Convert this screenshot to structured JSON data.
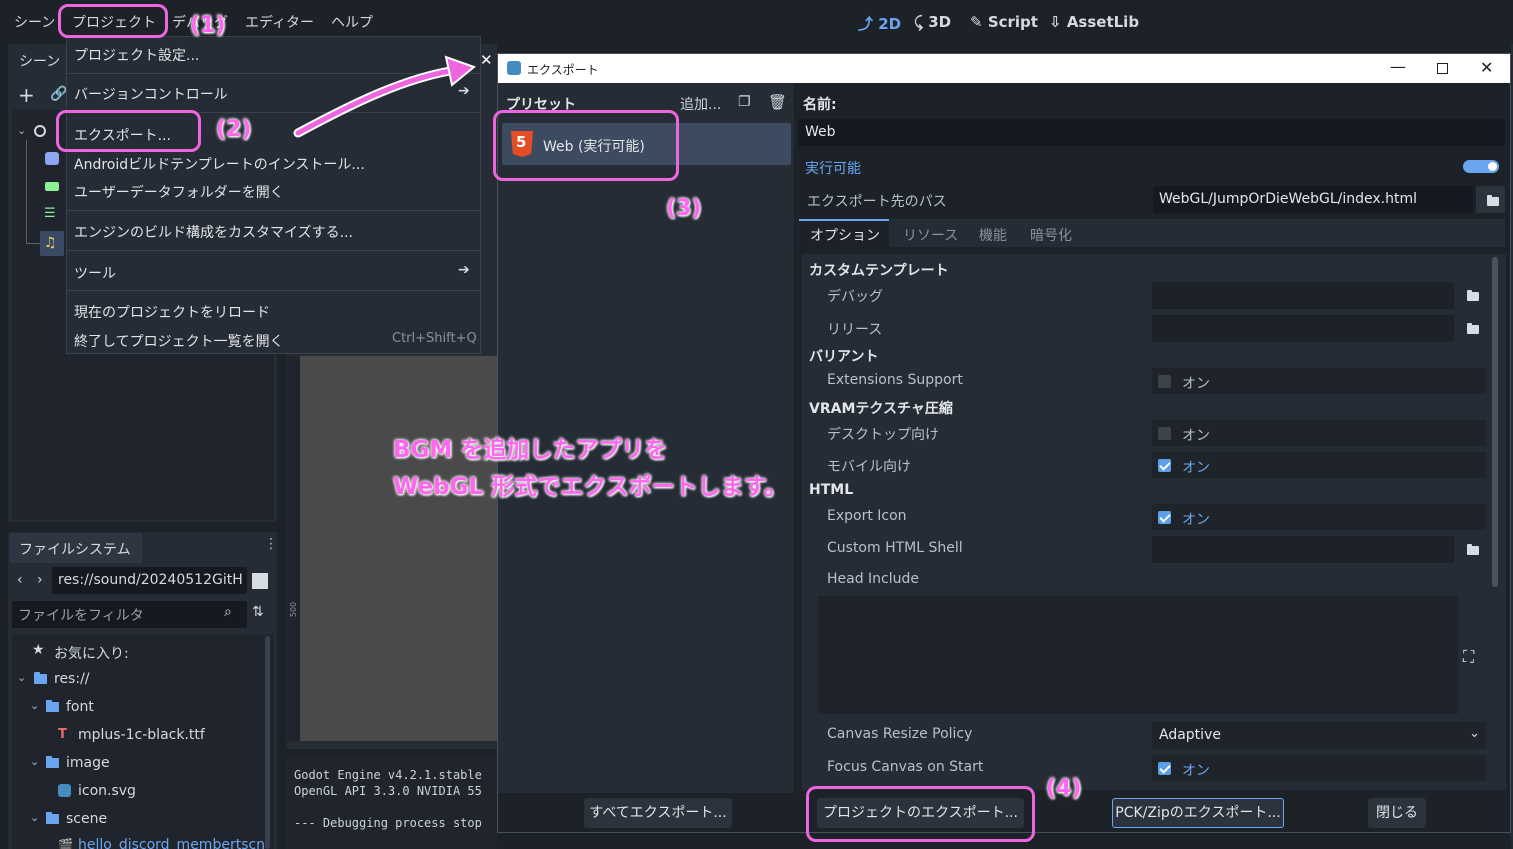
{
  "menubar": {
    "items": [
      "シーン",
      "プロジェクト",
      "デバッグ",
      "エディター",
      "ヘルプ"
    ],
    "modes": [
      "2D",
      "3D",
      "Script",
      "AssetLib"
    ]
  },
  "project_menu": {
    "items": [
      "プロジェクト設定...",
      "バージョンコントロール",
      "エクスポート...",
      "Androidビルドテンプレートのインストール...",
      "ユーザーデータフォルダーを開く",
      "エンジンのビルド構成をカスタマイズする...",
      "ツール",
      "現在のプロジェクトをリロード",
      "終了してプロジェクト一覧を開く"
    ],
    "quit_shortcut": "Ctrl+Shift+Q"
  },
  "scene_dock": {
    "tab": "シーン"
  },
  "filesystem": {
    "tab": "ファイルシステム",
    "path": "res://sound/20240512GitH",
    "filter_placeholder": "ファイルをフィルタ",
    "favorites": "お気に入り:",
    "tree": [
      "res://",
      "font",
      "mplus-1c-black.ttf",
      "image",
      "icon.svg",
      "scene",
      "hello_discord_membertscn"
    ]
  },
  "output": {
    "lines": [
      "Godot Engine v4.2.1.stable",
      "OpenGL API 3.3.0 NVIDIA 55",
      "--- Debugging process stop"
    ]
  },
  "ruler_label": "500",
  "dialog": {
    "title": "エクスポート",
    "presets_label": "プリセット",
    "add_label": "追加...",
    "preset_name": "Web (実行可能)",
    "name_label": "名前:",
    "name_value": "Web",
    "runnable_label": "実行可能",
    "export_path_label": "エクスポート先のパス",
    "export_path_value": "WebGL/JumpOrDieWebGL/index.html",
    "tabs": [
      "オプション",
      "リソース",
      "機能",
      "暗号化"
    ],
    "sections": {
      "custom_template": "カスタムテンプレート",
      "debug": "デバッグ",
      "release": "リリース",
      "variant": "バリアント",
      "extensions_support": "Extensions Support",
      "vram": "VRAMテクスチャ圧縮",
      "desktop": "デスクトップ向け",
      "mobile": "モバイル向け",
      "html": "HTML",
      "export_icon": "Export Icon",
      "custom_html_shell": "Custom HTML Shell",
      "head_include": "Head Include",
      "canvas_resize_policy": "Canvas Resize Policy",
      "canvas_resize_value": "Adaptive",
      "focus_canvas": "Focus Canvas on Start"
    },
    "on_label": "オン",
    "buttons": {
      "export_all": "すべてエクスポート...",
      "export_project": "プロジェクトのエクスポート...",
      "export_pck": "PCK/Zipのエクスポート...",
      "close": "閉じる"
    }
  },
  "annotations": {
    "step1": "(1)",
    "step2": "(2)",
    "step3": "(3)",
    "step4": "(4)",
    "caption_line1": "BGM を追加したアプリを",
    "caption_line2": "WebGL 形式でエクスポートします。"
  },
  "colors": {
    "accent": "#6aa6f0",
    "highlight": "#ee66dd",
    "background": "#1d2229",
    "panel": "#262c36"
  }
}
